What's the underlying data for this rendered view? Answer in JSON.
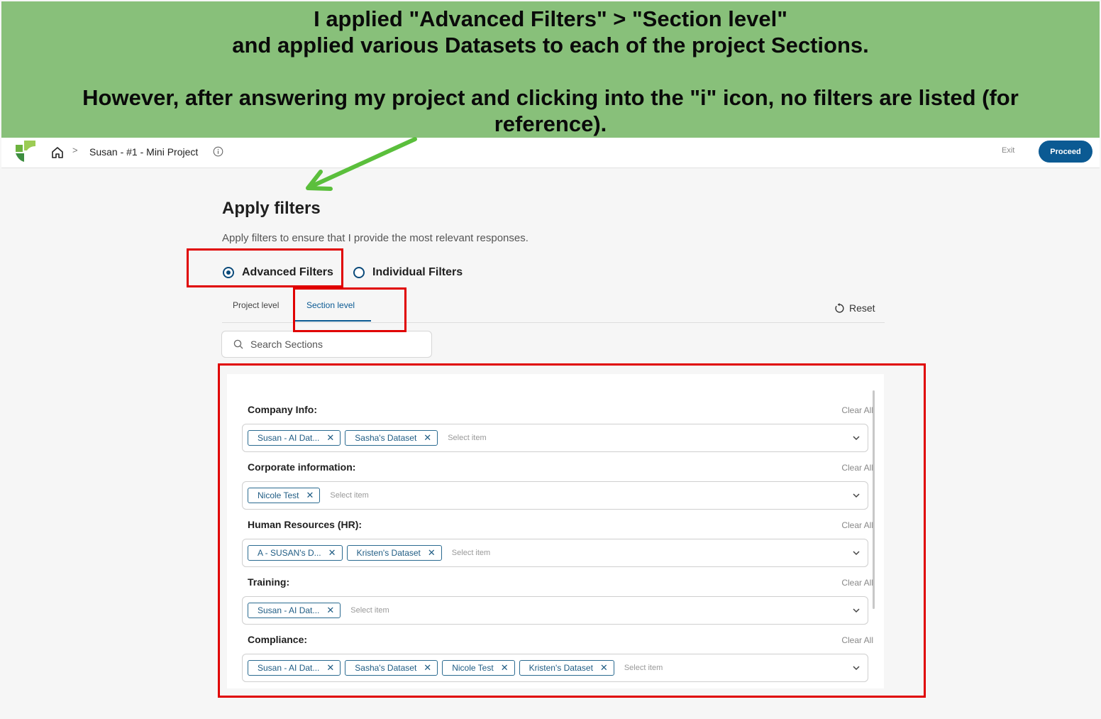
{
  "annotation": {
    "line1": "I applied \"Advanced Filters\" > \"Section level\"",
    "line2": "and applied various Datasets to each of the project Sections.",
    "line3": "However, after answering my project and clicking into the \"i\" icon, no filters are listed (for reference)."
  },
  "header": {
    "breadcrumb_sep": ">",
    "project_title": "Susan - #1 - Mini Project",
    "exit_label": "Exit",
    "proceed_label": "Proceed"
  },
  "main": {
    "title": "Apply filters",
    "subtitle": "Apply filters to ensure that I provide the most relevant responses.",
    "radio_advanced": "Advanced Filters",
    "radio_individual": "Individual Filters",
    "selected_radio": "Advanced Filters",
    "tab_project": "Project level",
    "tab_section": "Section level",
    "active_tab": "Section level",
    "reset_label": "Reset",
    "search_placeholder": "Search Sections"
  },
  "sections": [
    {
      "label": "Company Info:",
      "clear": "Clear All",
      "chips": [
        "Susan - AI Dat...",
        "Sasha's Dataset"
      ],
      "placeholder": "Select item"
    },
    {
      "label": "Corporate information:",
      "clear": "Clear All",
      "chips": [
        "Nicole Test"
      ],
      "placeholder": "Select item"
    },
    {
      "label": "Human Resources (HR):",
      "clear": "Clear All",
      "chips": [
        "A - SUSAN's D...",
        "Kristen's Dataset"
      ],
      "placeholder": "Select item"
    },
    {
      "label": "Training:",
      "clear": "Clear All",
      "chips": [
        "Susan - AI Dat..."
      ],
      "placeholder": "Select item"
    },
    {
      "label": "Compliance:",
      "clear": "Clear All",
      "chips": [
        "Susan - AI Dat...",
        "Sasha's Dataset",
        "Nicole Test",
        "Kristen's Dataset"
      ],
      "placeholder": "Select item"
    }
  ],
  "colors": {
    "banner": "#88c07a",
    "accent": "#0b5a93",
    "highlight": "#e00000",
    "arrow": "#5bbf3c"
  },
  "icons": [
    "logo-icon",
    "home-icon",
    "chevron-right-icon",
    "info-icon",
    "reset-icon",
    "search-icon",
    "chevron-down-icon",
    "close-icon"
  ]
}
